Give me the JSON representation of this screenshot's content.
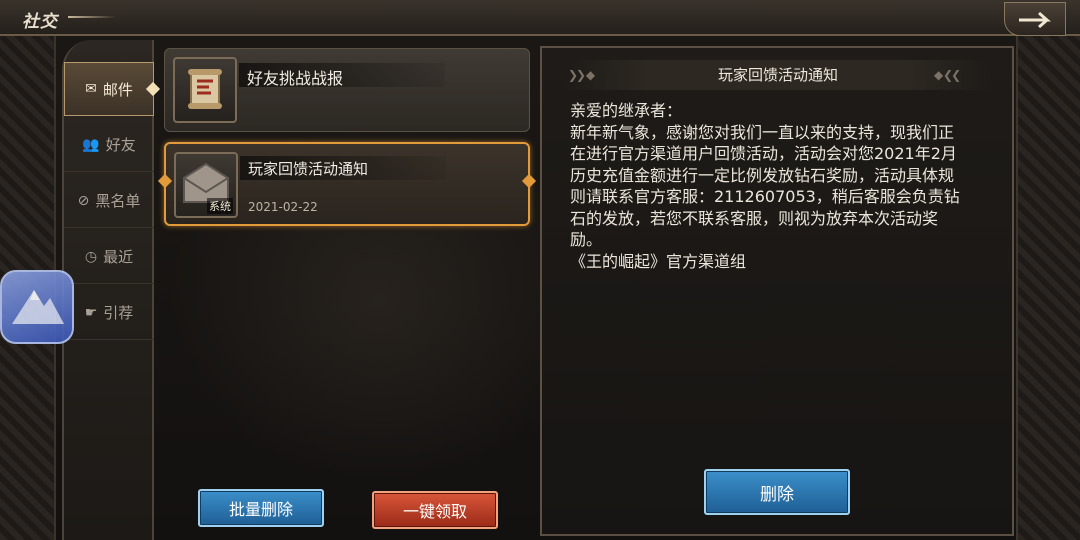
{
  "header": {
    "title": "社交"
  },
  "tabs": [
    {
      "label": "邮件",
      "icon": "envelope-icon",
      "glyph": "✉",
      "active": true
    },
    {
      "label": "好友",
      "icon": "friend-icon",
      "glyph": "👥",
      "active": false
    },
    {
      "label": "黑名单",
      "icon": "blacklist-icon",
      "glyph": "⊘",
      "active": false
    },
    {
      "label": "最近",
      "icon": "clock-icon",
      "glyph": "◷",
      "active": false
    },
    {
      "label": "引荐",
      "icon": "handshake-icon",
      "glyph": "☛",
      "active": false
    }
  ],
  "mails": [
    {
      "subject": "好友挑战战报",
      "date": "",
      "icon": "scroll-icon",
      "badge": "",
      "selected": false
    },
    {
      "subject": "玩家回馈活动通知",
      "date": "2021-02-22",
      "icon": "envelope-icon",
      "badge": "系统",
      "selected": true
    }
  ],
  "detail": {
    "title": "玩家回馈活动通知",
    "greeting": "亲爱的继承者：",
    "body_lines": [
      "新年新气象，感谢您对我们一直以来的支持，现我们正",
      "在进行官方渠道用户回馈活动，活动会对您2021年2月",
      "历史充值金额进行一定比例发放钻石奖励，活动具体规",
      "则请联系官方客服：2112607053，稍后客服会负责钻",
      "石的发放，若您不联系客服，则视为放弃本次活动奖",
      "励。"
    ],
    "signature": "《王的崛起》官方渠道组",
    "delete_label": "删除"
  },
  "footer": {
    "batch_delete_label": "批量删除",
    "claim_all_label": "一键领取"
  },
  "colors": {
    "accent_orange": "#e29a3b",
    "button_blue": "#1f5f95",
    "button_red": "#9a2a18"
  }
}
